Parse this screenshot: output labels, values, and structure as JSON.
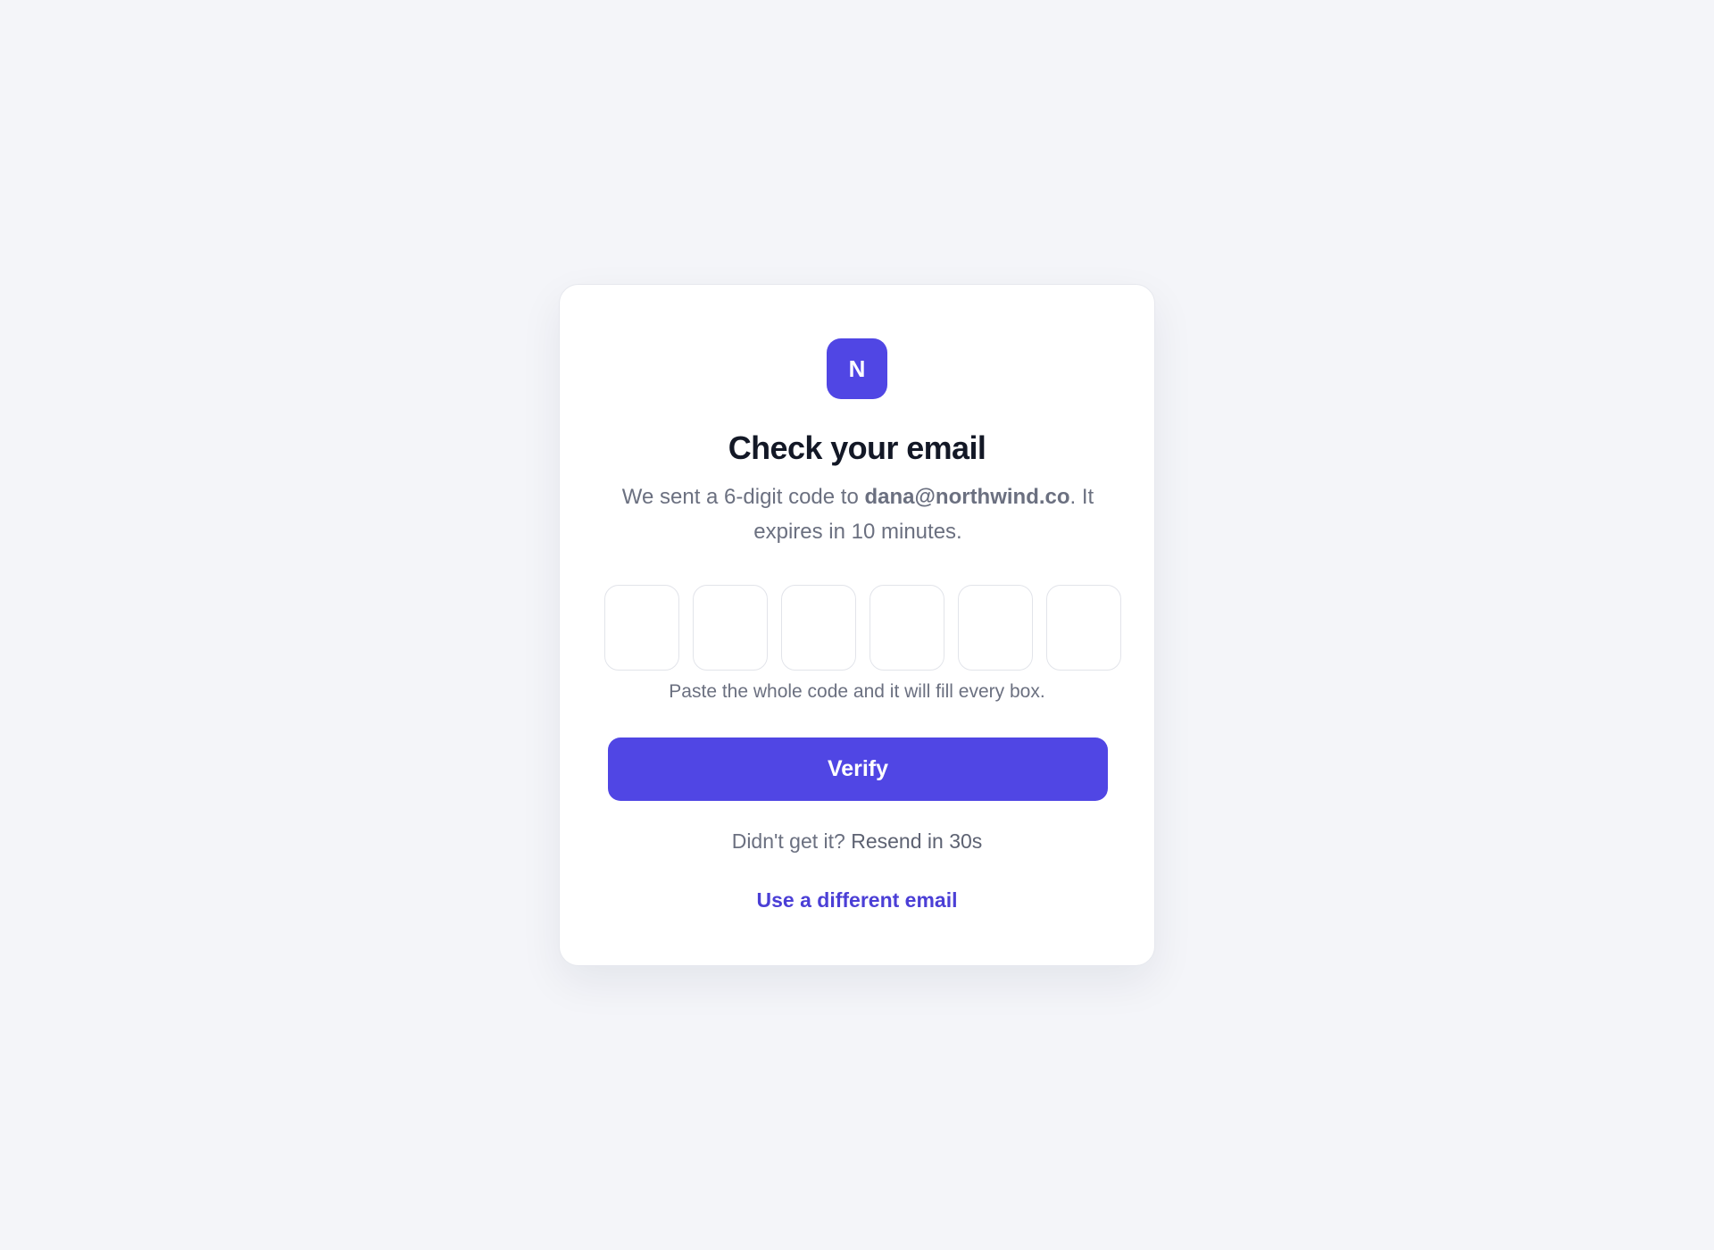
{
  "brand": {
    "logo_letter": "N",
    "accent_color": "#5046e4"
  },
  "title": "Check your email",
  "subtitle": {
    "prefix": "We sent a 6-digit code to ",
    "email": "dana@northwind.co",
    "suffix": ". It expires in 10 minutes."
  },
  "otp": {
    "digits": [
      "",
      "",
      "",
      "",
      "",
      ""
    ]
  },
  "hint": "Paste the whole code and it will fill every box.",
  "verify_label": "Verify",
  "resend": {
    "prefix": "Didn't get it? ",
    "timer_label": "Resend in 30s"
  },
  "different_email_label": "Use a different email"
}
